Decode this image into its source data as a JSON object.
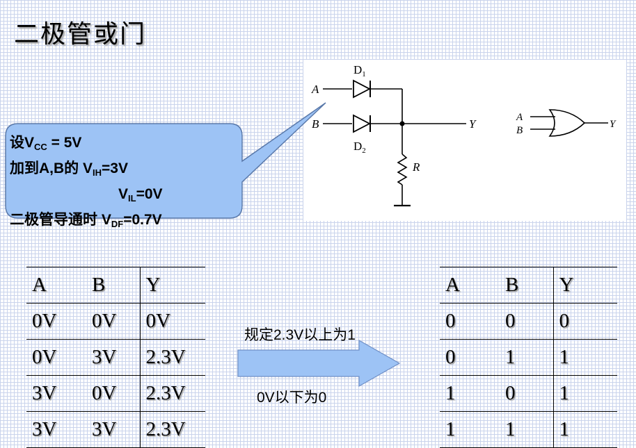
{
  "title": "二极管或门",
  "circuit": {
    "input_a": "A",
    "input_b": "B",
    "output_y": "Y",
    "diode1": {
      "letter": "D",
      "sub": "1"
    },
    "diode2": {
      "letter": "D",
      "sub": "2"
    },
    "resistor": "R",
    "gate": {
      "input_a": "A",
      "input_b": "B",
      "output": "Y"
    }
  },
  "callout": {
    "line1": {
      "prefix": "设V",
      "sub": "CC",
      "suffix": " = 5V"
    },
    "line2": {
      "prefix": "加到A,B的    V",
      "sub": "IH",
      "suffix": "=3V"
    },
    "line3": {
      "prefix": "V",
      "sub": "IL",
      "suffix": "=0V"
    },
    "line4": {
      "prefix": "二极管导通时   V",
      "sub": "DF",
      "suffix": "=0.7V"
    }
  },
  "left_table": {
    "headers": [
      "A",
      "B",
      "Y"
    ],
    "rows": [
      [
        "0V",
        "0V",
        "0V"
      ],
      [
        "0V",
        "3V",
        "2.3V"
      ],
      [
        "3V",
        "0V",
        "2.3V"
      ],
      [
        "3V",
        "3V",
        "2.3V"
      ]
    ]
  },
  "arrow": {
    "top_label": "规定2.3V以上为1",
    "bottom_label": "0V以下为0"
  },
  "right_table": {
    "headers": [
      "A",
      "B",
      "Y"
    ],
    "rows": [
      [
        "0",
        "0",
        "0"
      ],
      [
        "0",
        "1",
        "1"
      ],
      [
        "1",
        "0",
        "1"
      ],
      [
        "1",
        "1",
        "1"
      ]
    ]
  },
  "colors": {
    "callout_fill": "#9dc3f5",
    "arrow_fill": "#9dc3f5",
    "grid": "#c9d3ec"
  }
}
